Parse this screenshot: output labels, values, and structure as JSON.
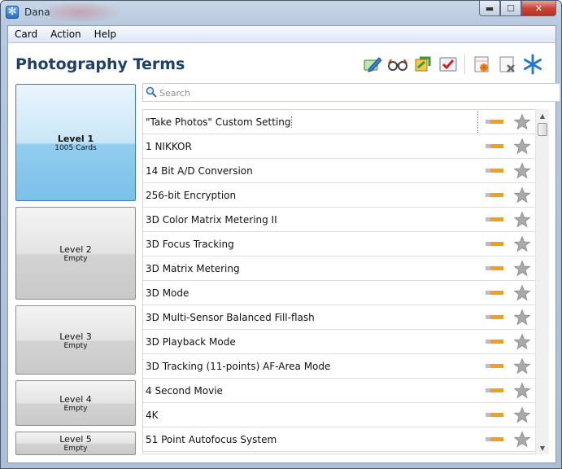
{
  "window": {
    "title": "Dana",
    "minimize_glyph": "▬",
    "maximize_glyph": "☐",
    "close_glyph": "✕",
    "app_icon": "snowflake-icon"
  },
  "menu": [
    {
      "label": "Card"
    },
    {
      "label": "Action"
    },
    {
      "label": "Help"
    }
  ],
  "page_title": "Photography Terms",
  "toolbar": {
    "icons": [
      "edit-card-icon",
      "review-glasses-icon",
      "shuffle-icon",
      "check-icon",
      "new-card-icon",
      "delete-card-icon",
      "snowflake-icon"
    ]
  },
  "levels": [
    {
      "name": "Level 1",
      "count": "1005 Cards",
      "active": true
    },
    {
      "name": "Level 2",
      "count": "Empty",
      "active": false
    },
    {
      "name": "Level 3",
      "count": "Empty",
      "active": false
    },
    {
      "name": "Level 4",
      "count": "Empty",
      "active": false
    },
    {
      "name": "Level 5",
      "count": "Empty",
      "active": false
    }
  ],
  "search": {
    "placeholder": "Search",
    "value": ""
  },
  "cards": [
    {
      "term": "\"Take Photos\" Custom Setting"
    },
    {
      "term": "1 NIKKOR"
    },
    {
      "term": "14 Bit A/D Conversion"
    },
    {
      "term": "256-bit Encryption"
    },
    {
      "term": "3D Color Matrix Metering II"
    },
    {
      "term": "3D Focus Tracking"
    },
    {
      "term": "3D Matrix Metering"
    },
    {
      "term": "3D Mode"
    },
    {
      "term": "3D Multi-Sensor Balanced Fill-flash"
    },
    {
      "term": "3D Playback Mode"
    },
    {
      "term": "3D Tracking (11-points) AF-Area Mode"
    },
    {
      "term": "4 Second Movie"
    },
    {
      "term": "4K"
    },
    {
      "term": "51 Point Autofocus System"
    }
  ],
  "colors": {
    "title": "#1f3f66",
    "level_bar_orange": "#f0a020",
    "level_bar_gray": "#bdbdbd",
    "star_gray": "#a9a9a9",
    "active_level": "#7cc0ea"
  }
}
